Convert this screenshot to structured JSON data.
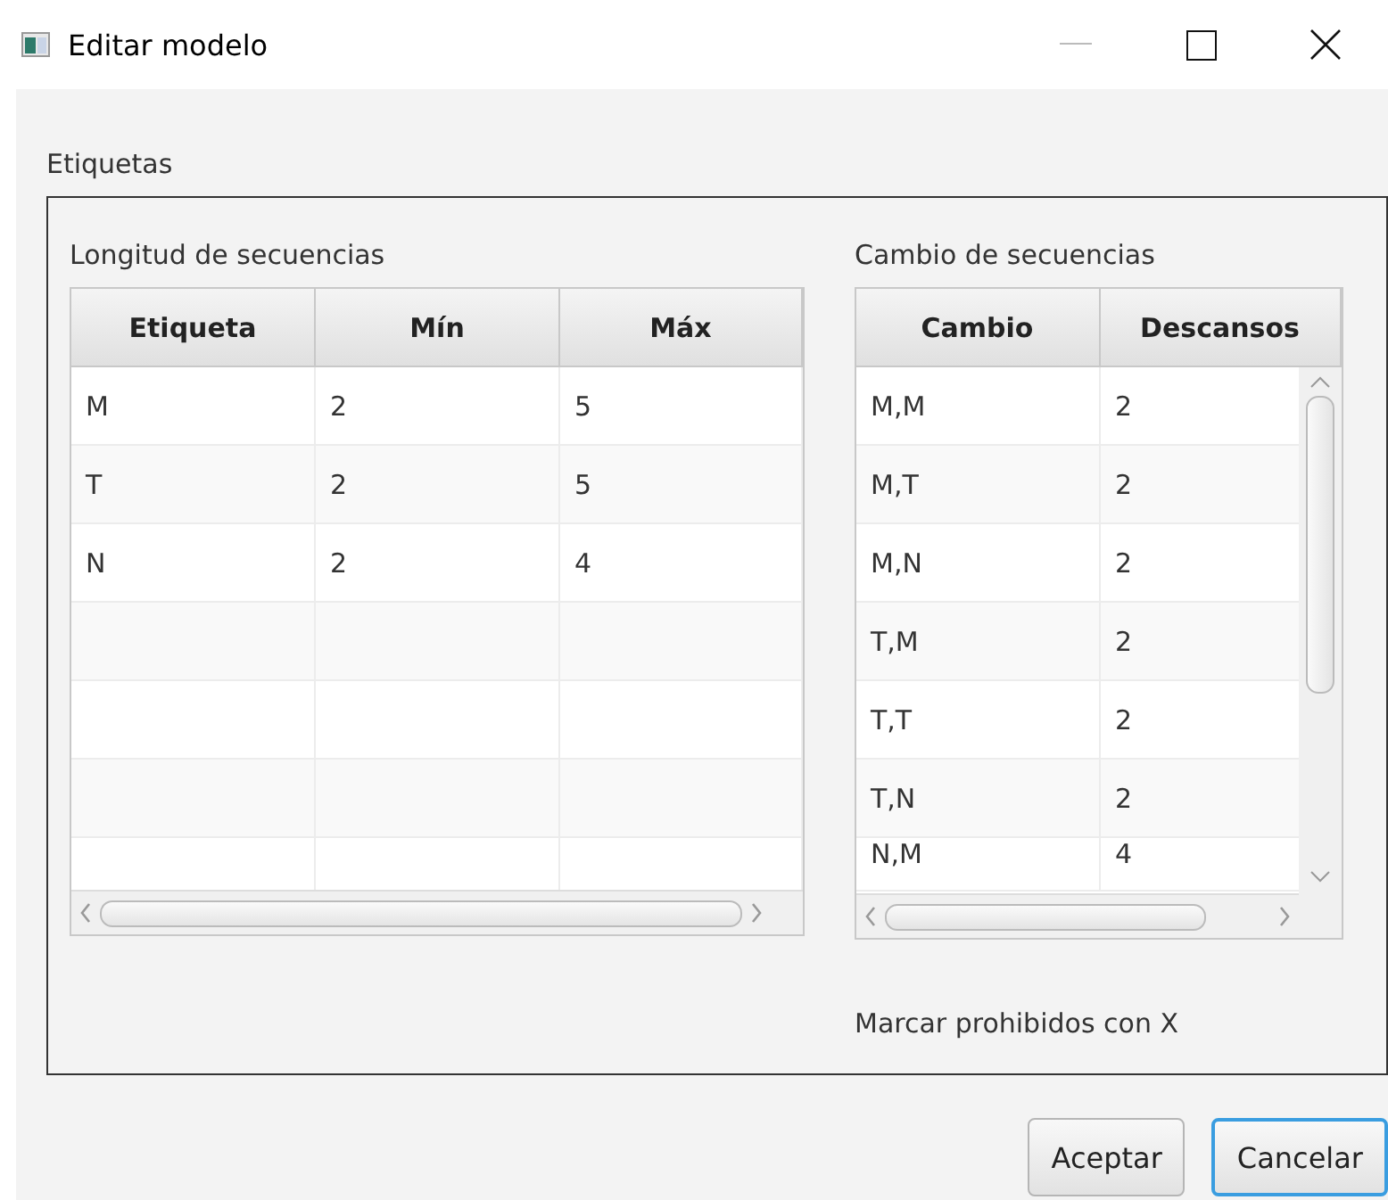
{
  "window": {
    "title": "Editar modelo"
  },
  "group": {
    "title": "Etiquetas"
  },
  "lengths": {
    "title": "Longitud de secuencias",
    "columns": [
      "Etiqueta",
      "Mín",
      "Máx"
    ],
    "rows": [
      [
        "M",
        "2",
        "5"
      ],
      [
        "T",
        "2",
        "5"
      ],
      [
        "N",
        "2",
        "4"
      ]
    ]
  },
  "changes": {
    "title": "Cambio de secuencias",
    "columns": [
      "Cambio",
      "Descansos"
    ],
    "rows": [
      [
        "M,M",
        "2"
      ],
      [
        "M,T",
        "2"
      ],
      [
        "M,N",
        "2"
      ],
      [
        "T,M",
        "2"
      ],
      [
        "T,T",
        "2"
      ],
      [
        "T,N",
        "2"
      ],
      [
        "N,M",
        "4"
      ]
    ]
  },
  "hint": "Marcar prohibidos con X",
  "buttons": [
    {
      "label": "Aceptar",
      "focused": false
    },
    {
      "label": "Cancelar",
      "focused": true
    }
  ]
}
